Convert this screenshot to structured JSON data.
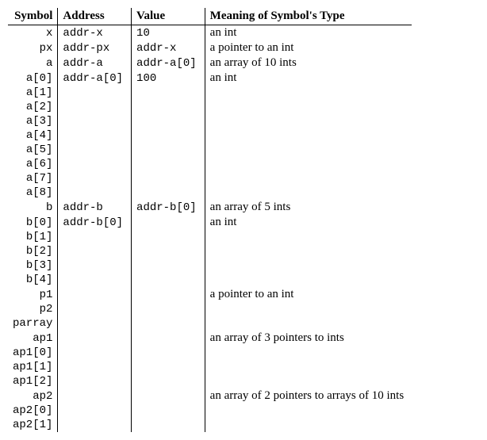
{
  "headers": {
    "symbol": "Symbol",
    "address": "Address",
    "value": "Value",
    "meaning": "Meaning of Symbol's Type"
  },
  "rows": [
    {
      "symbol": "x",
      "address": "addr-x",
      "value": "10",
      "meaning": "an int"
    },
    {
      "symbol": "px",
      "address": "addr-px",
      "value": "addr-x",
      "meaning": "a pointer to an int"
    },
    {
      "symbol": "a",
      "address": "addr-a",
      "value": "addr-a[0]",
      "meaning": "an array of 10 ints"
    },
    {
      "symbol": "a[0]",
      "address": "addr-a[0]",
      "value": "100",
      "meaning": "an int"
    },
    {
      "symbol": "a[1]",
      "address": "",
      "value": "",
      "meaning": ""
    },
    {
      "symbol": "a[2]",
      "address": "",
      "value": "",
      "meaning": ""
    },
    {
      "symbol": "a[3]",
      "address": "",
      "value": "",
      "meaning": ""
    },
    {
      "symbol": "a[4]",
      "address": "",
      "value": "",
      "meaning": ""
    },
    {
      "symbol": "a[5]",
      "address": "",
      "value": "",
      "meaning": ""
    },
    {
      "symbol": "a[6]",
      "address": "",
      "value": "",
      "meaning": ""
    },
    {
      "symbol": "a[7]",
      "address": "",
      "value": "",
      "meaning": ""
    },
    {
      "symbol": "a[8]",
      "address": "",
      "value": "",
      "meaning": ""
    },
    {
      "symbol": "b",
      "address": "addr-b",
      "value": "addr-b[0]",
      "meaning": "an array of 5 ints"
    },
    {
      "symbol": "b[0]",
      "address": "addr-b[0]",
      "value": "",
      "meaning": "an int"
    },
    {
      "symbol": "b[1]",
      "address": "",
      "value": "",
      "meaning": ""
    },
    {
      "symbol": "b[2]",
      "address": "",
      "value": "",
      "meaning": ""
    },
    {
      "symbol": "b[3]",
      "address": "",
      "value": "",
      "meaning": ""
    },
    {
      "symbol": "b[4]",
      "address": "",
      "value": "",
      "meaning": ""
    },
    {
      "symbol": "p1",
      "address": "",
      "value": "",
      "meaning": "a pointer to an int"
    },
    {
      "symbol": "p2",
      "address": "",
      "value": "",
      "meaning": ""
    },
    {
      "symbol": "parray",
      "address": "",
      "value": "",
      "meaning": ""
    },
    {
      "symbol": "ap1",
      "address": "",
      "value": "",
      "meaning": "an array of 3 pointers to ints"
    },
    {
      "symbol": "ap1[0]",
      "address": "",
      "value": "",
      "meaning": ""
    },
    {
      "symbol": "ap1[1]",
      "address": "",
      "value": "",
      "meaning": ""
    },
    {
      "symbol": "ap1[2]",
      "address": "",
      "value": "",
      "meaning": ""
    },
    {
      "symbol": "ap2",
      "address": "",
      "value": "",
      "meaning": "an array of 2 pointers to arrays of 10 ints"
    },
    {
      "symbol": "ap2[0]",
      "address": "",
      "value": "",
      "meaning": ""
    },
    {
      "symbol": "ap2[1]",
      "address": "",
      "value": "",
      "meaning": ""
    }
  ]
}
